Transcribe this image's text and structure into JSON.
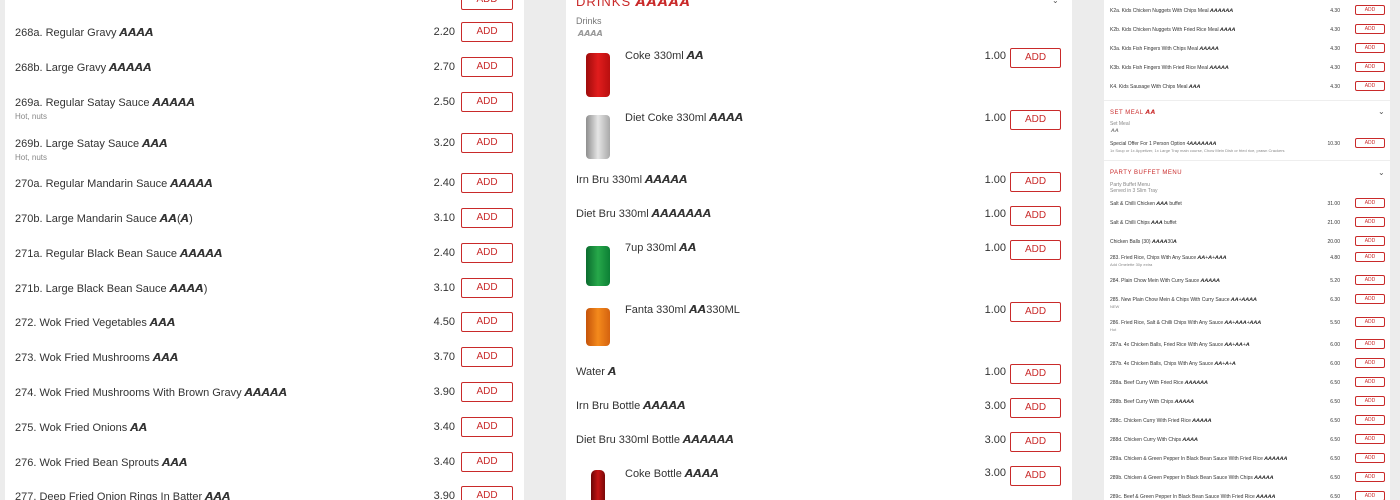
{
  "panel1": {
    "items": [
      {
        "name": "268a. Regular Gravy 𝘼𝘼𝘼𝘼",
        "price": "2.20",
        "add": "ADD",
        "desc": ""
      },
      {
        "name": "268b. Large Gravy 𝘼𝘼𝘼𝘼𝘼",
        "price": "2.70",
        "add": "ADD",
        "desc": ""
      },
      {
        "name": "269a. Regular Satay Sauce 𝘼𝘼𝘼𝘼𝘼",
        "price": "2.50",
        "add": "ADD",
        "desc": "Hot, nuts"
      },
      {
        "name": "269b. Large Satay Sauce 𝘼𝘼𝘼",
        "price": "3.20",
        "add": "ADD",
        "desc": "Hot, nuts"
      },
      {
        "name": "270a. Regular Mandarin Sauce 𝘼𝘼𝘼𝘼𝘼",
        "price": "2.40",
        "add": "ADD",
        "desc": ""
      },
      {
        "name": "270b. Large Mandarin Sauce 𝘼𝘼(𝘼)",
        "price": "3.10",
        "add": "ADD",
        "desc": ""
      },
      {
        "name": "271a. Regular Black Bean Sauce 𝘼𝘼𝘼𝘼𝘼",
        "price": "2.40",
        "add": "ADD",
        "desc": ""
      },
      {
        "name": "271b. Large Black Bean Sauce 𝘼𝘼𝘼𝘼)",
        "price": "3.10",
        "add": "ADD",
        "desc": ""
      },
      {
        "name": "272. Wok Fried Vegetables 𝘼𝘼𝘼",
        "price": "4.50",
        "add": "ADD",
        "desc": ""
      },
      {
        "name": "273. Wok Fried Mushrooms 𝘼𝘼𝘼",
        "price": "3.70",
        "add": "ADD",
        "desc": ""
      },
      {
        "name": "274. Wok Fried Mushrooms With Brown Gravy 𝘼𝘼𝘼𝘼𝘼",
        "price": "3.90",
        "add": "ADD",
        "desc": ""
      },
      {
        "name": "275. Wok Fried Onions 𝘼𝘼",
        "price": "3.40",
        "add": "ADD",
        "desc": ""
      },
      {
        "name": "276. Wok Fried Bean Sprouts 𝘼𝘼𝘼",
        "price": "3.40",
        "add": "ADD",
        "desc": ""
      },
      {
        "name": "277. Deep Fried Onion Rings In Batter 𝘼𝘼𝘼",
        "price": "3.90",
        "add": "ADD",
        "desc": ""
      }
    ]
  },
  "panel2": {
    "section_title": "DRINKS 𝘼𝘼𝘼𝘼𝘼",
    "section_desc": "Drinks",
    "section_desc2": "𝘼𝘼𝘼𝘼",
    "items": [
      {
        "name": "Coke 330ml 𝘼𝘼",
        "price": "1.00",
        "add": "ADD",
        "image": "red-can"
      },
      {
        "name": "Diet Coke 330ml 𝘼𝘼𝘼𝘼",
        "price": "1.00",
        "add": "ADD",
        "image": "silver-can"
      },
      {
        "name": "Irn Bru 330ml 𝘼𝘼𝘼𝘼𝘼",
        "price": "1.00",
        "add": "ADD",
        "image": ""
      },
      {
        "name": "Diet Bru 330ml 𝘼𝘼𝘼𝘼𝘼𝘼𝘼",
        "price": "1.00",
        "add": "ADD",
        "image": ""
      },
      {
        "name": "7up 330ml 𝘼𝘼",
        "price": "1.00",
        "add": "ADD",
        "image": "green-can"
      },
      {
        "name": "Fanta 330ml 𝘼𝘼330ML",
        "price": "1.00",
        "add": "ADD",
        "image": "orange-can"
      },
      {
        "name": "Water 𝘼",
        "price": "1.00",
        "add": "ADD",
        "image": ""
      },
      {
        "name": "Irn Bru Bottle 𝘼𝘼𝘼𝘼𝘼",
        "price": "3.00",
        "add": "ADD",
        "image": ""
      },
      {
        "name": "Diet Bru 330ml Bottle 𝘼𝘼𝘼𝘼𝘼𝘼",
        "price": "3.00",
        "add": "ADD",
        "image": ""
      },
      {
        "name": "Coke Bottle 𝘼𝘼𝘼𝘼",
        "price": "3.00",
        "add": "ADD",
        "image": "red-bottle"
      }
    ]
  },
  "panel3": {
    "kids_items": [
      {
        "name": "K2a. Kids Chicken Nuggets With Chips Meal 𝘼𝘼𝘼𝘼𝘼𝘼",
        "price": "4.30",
        "add": "ADD"
      },
      {
        "name": "K2b. Kids Chicken Nuggets With Fried Rice Meal 𝘼𝘼𝘼𝘼",
        "price": "4.30",
        "add": "ADD"
      },
      {
        "name": "K3a. Kids Fish Fingers With Chips Meal 𝘼𝘼𝘼𝘼𝘼",
        "price": "4.30",
        "add": "ADD"
      },
      {
        "name": "K3b. Kids Fish Fingers With Fried Rice Meal 𝘼𝘼𝘼𝘼𝘼",
        "price": "4.30",
        "add": "ADD"
      },
      {
        "name": "K4. Kids Sausage With Chips Meal 𝘼𝘼𝘼",
        "price": "4.30",
        "add": "ADD"
      }
    ],
    "set_meal": {
      "title": "SET MEAL 𝘼𝘼",
      "desc": "Set Meal",
      "desc2": "𝘼𝘼",
      "items": [
        {
          "name": "Special Offer For 1 Person Option 4𝘼𝘼𝘼𝘼𝘼𝘼𝘼",
          "desc": "1x Soup or 1x Appetizer, 1x Large Tray main course, Chow Mein Dish or fried rice, prawn Crackers",
          "price": "10.30",
          "add": "ADD"
        }
      ]
    },
    "party": {
      "title": "PARTY BUFFET MENU",
      "desc": "Party Buffet Menu",
      "desc2": "Served in 3 Slim Tray",
      "items": [
        {
          "name": "Salt & Chilli Chicken 𝘼𝘼𝘼 buffet",
          "price": "31.00",
          "add": "ADD",
          "desc": ""
        },
        {
          "name": "Salt & Chilli Chips 𝘼𝘼𝘼 buffet",
          "price": "21.00",
          "add": "ADD",
          "desc": ""
        },
        {
          "name": "Chicken Balls (30) 𝘼𝘼𝘼𝘼30𝘼",
          "price": "20.00",
          "add": "ADD",
          "desc": ""
        },
        {
          "name": "283. Fried Rice, Chips With Any Sauce 𝘼𝘼+𝘼+𝘼𝘼𝘼",
          "price": "4.80",
          "add": "ADD",
          "desc": "Add Omelette 30p extra"
        },
        {
          "name": "284. Plain Chow Mein With Curry Sauce 𝘼𝘼𝘼𝘼𝘼",
          "price": "5.20",
          "add": "ADD",
          "desc": ""
        },
        {
          "name": "285. New Plain Chow Mein & Chips With Curry Sauce 𝘼𝘼+𝘼𝘼𝘼𝘼",
          "price": "6.30",
          "add": "ADD",
          "desc": "NEW"
        },
        {
          "name": "286. Fried Rice, Salt & Chilli Chips With Any Sauce 𝘼𝘼+𝘼𝘼𝘼+𝘼𝘼𝘼",
          "price": "5.50",
          "add": "ADD",
          "desc": "Hot"
        },
        {
          "name": "287a. 4x Chicken Balls, Fried Rice With Any Sauce 𝘼𝘼+𝘼𝘼+𝘼",
          "price": "6.00",
          "add": "ADD",
          "desc": ""
        },
        {
          "name": "287b. 4x Chicken Balls, Chips With Any Sauce 𝘼𝘼+𝘼+𝘼",
          "price": "6.00",
          "add": "ADD",
          "desc": ""
        },
        {
          "name": "288a. Beef Curry With Fried Rice 𝘼𝘼𝘼𝘼𝘼𝘼",
          "price": "6.50",
          "add": "ADD",
          "desc": ""
        },
        {
          "name": "288b. Beef Curry With Chips 𝘼𝘼𝘼𝘼𝘼",
          "price": "6.50",
          "add": "ADD",
          "desc": ""
        },
        {
          "name": "288c. Chicken Curry With Fried Rice 𝘼𝘼𝘼𝘼𝘼",
          "price": "6.50",
          "add": "ADD",
          "desc": ""
        },
        {
          "name": "288d. Chicken Curry With Chips 𝘼𝘼𝘼𝘼",
          "price": "6.50",
          "add": "ADD",
          "desc": ""
        },
        {
          "name": "289a. Chicken & Green Pepper In Black Bean Sauce With Fried Rice 𝘼𝘼𝘼𝘼𝘼𝘼",
          "price": "6.50",
          "add": "ADD",
          "desc": ""
        },
        {
          "name": "289b. Chicken & Green Pepper In Black Bean Sauce With Chips 𝘼𝘼𝘼𝘼𝘼",
          "price": "6.50",
          "add": "ADD",
          "desc": ""
        },
        {
          "name": "289c. Beef & Green Pepper In Black Bean Sauce With Fried Rice 𝘼𝘼𝘼𝘼𝘼",
          "price": "6.50",
          "add": "ADD",
          "desc": ""
        }
      ]
    }
  },
  "colors": {
    "accent": "#c92a2a",
    "background": "#ececec",
    "panel": "#ffffff"
  }
}
